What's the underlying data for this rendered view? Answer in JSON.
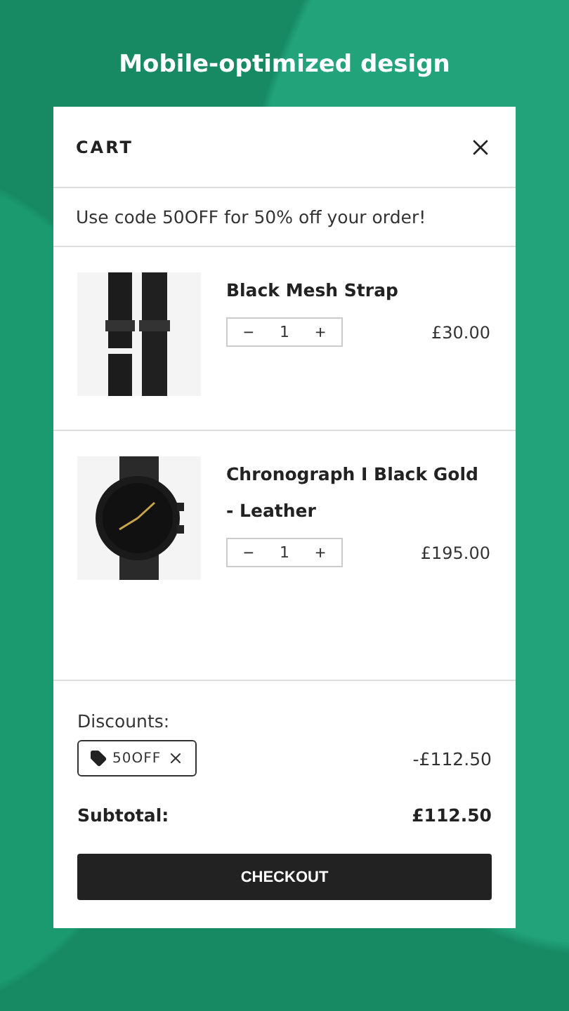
{
  "headline": "Mobile-optimized design",
  "cart": {
    "title": "CART",
    "promo": "Use code 50OFF for 50% off your order!",
    "items": [
      {
        "name": "Black Mesh Strap",
        "quantity": "1",
        "minus": "−",
        "plus": "+",
        "price": "£30.00"
      },
      {
        "name": "Chronograph I Black Gold - Leather",
        "quantity": "1",
        "minus": "−",
        "plus": "+",
        "price": "£195.00"
      }
    ],
    "discounts_label": "Discounts:",
    "discount_code": "50OFF",
    "discount_amount": "-£112.50",
    "subtotal_label": "Subtotal:",
    "subtotal": "£112.50",
    "checkout": "CHECKOUT"
  }
}
